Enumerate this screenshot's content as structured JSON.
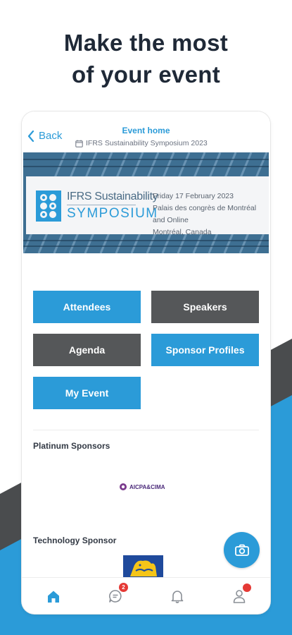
{
  "headline": {
    "line1": "Make the most",
    "line2": "of your event"
  },
  "colors": {
    "accent": "#2b9bd8",
    "dark_tile": "#555759",
    "badge": "#e53935",
    "bg_shape_dark": "#4a4c4e",
    "bg_shape_blue": "#2b9bd8"
  },
  "nav": {
    "back_label": "Back",
    "title": "Event home",
    "subtitle": "IFRS Sustainability Symposium 2023",
    "back_icon": "chevron-left-icon",
    "calendar_icon": "calendar-icon"
  },
  "banner": {
    "logo_line1": "IFRS Sustainability",
    "logo_line2": "SYMPOSIUM",
    "date": "Friday 17 February 2023",
    "venue": "Palais des congrès de Montréal and Online",
    "city": "Montréal, Canada"
  },
  "tiles": {
    "attendees": "Attendees",
    "speakers": "Speakers",
    "agenda": "Agenda",
    "sponsor_profiles": "Sponsor Profiles",
    "my_event": "My Event"
  },
  "sections": {
    "platinum": "Platinum Sponsors",
    "technology": "Technology Sponsor"
  },
  "sponsors": {
    "platinum_logo_text": "AICPA&CIMA"
  },
  "fab": {
    "icon": "camera-icon"
  },
  "tabbar": {
    "home_icon": "home-icon",
    "messages_icon": "chat-icon",
    "messages_badge": "2",
    "notifications_icon": "bell-icon",
    "profile_icon": "person-icon"
  }
}
